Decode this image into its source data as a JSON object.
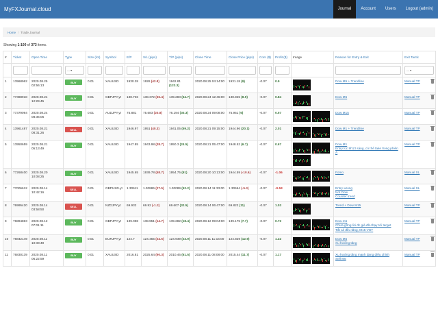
{
  "nav": {
    "brand": "MyFXJournal.cloud",
    "items": [
      {
        "label": "Journal",
        "active": true
      },
      {
        "label": "Account",
        "active": false
      },
      {
        "label": "Users",
        "active": false
      },
      {
        "label": "Logout (admin)",
        "active": false
      }
    ]
  },
  "breadcrumb": {
    "home": "Home",
    "current": "Trade Journal"
  },
  "summary": {
    "prefix": "Showing ",
    "range": "1-100",
    "mid": " of ",
    "total": "373",
    "suffix": " items."
  },
  "filter_select_value": "---",
  "columns": [
    "#",
    "Ticket",
    "Open Time",
    "Type",
    "Size (lot)",
    "Symbol",
    "E/P",
    "S/L (pips)",
    "T/P (pips)",
    "Close Time",
    "Close Price (pips)",
    "Com ($)",
    "Profit ($)",
    "Image",
    "Reason for Entry & Exit",
    "Exit Tactic"
  ],
  "colors": {
    "navbar": "#3b74b0",
    "buy": "#5cb85c",
    "sell": "#d9534f",
    "link": "#337ab7"
  },
  "rows": [
    {
      "no": "1",
      "ticket": "13968962",
      "open_date": "2020.08.25",
      "open_time": "02:56:13",
      "type": "BUY",
      "size": "0.01",
      "symbol": "XAUUSD",
      "ep": "1930.28",
      "sl": "1926",
      "sl_pips": "(42.8)",
      "tp": "1942.81",
      "tp_pips": "(123.3)",
      "close_time": "2020.08.25 04:14:00",
      "close_price": "1931.18",
      "close_pips": "(9)",
      "com": "-0.07",
      "profit": "0.9",
      "images": 1,
      "reasons": [
        "Dow M5 + Trendline"
      ],
      "tactic": "Manual TP"
    },
    {
      "no": "2",
      "ticket": "77388918",
      "open_date": "2020.08.24",
      "open_time": "12:29:45",
      "type": "BUY",
      "size": "0.01",
      "symbol": "GBPJPY.yt",
      "ep": "138.736",
      "sl": "138.372",
      "sl_pips": "(36.4)",
      "tp": "139.283",
      "tp_pips": "(54.7)",
      "close_time": "2020.08.24 12:46:00",
      "close_price": "138.825",
      "close_pips": "(8.9)",
      "com": "-0.07",
      "profit": "0.84",
      "images": 1,
      "reasons": [
        "Dow M5"
      ],
      "tactic": "Manual TP"
    },
    {
      "no": "3",
      "ticket": "77379094",
      "open_date": "2020.08.24",
      "open_time": "08:36:06",
      "type": "BUY",
      "size": "0.01",
      "symbol": "AUDJPY.yt",
      "ep": "75.881",
      "sl": "75.683",
      "sl_pips": "(20.8)",
      "tp": "76.194",
      "tp_pips": "(30.3)",
      "close_time": "2020.08.24 09:08:00",
      "close_price": "75.951",
      "close_pips": "(6)",
      "com": "-0.07",
      "profit": "0.57",
      "images": 2,
      "reasons": [
        "Dow M15"
      ],
      "tactic": "Manual TP"
    },
    {
      "no": "4",
      "ticket": "13961487",
      "open_date": "2020.08.21",
      "open_time": "08:31:26",
      "type": "SELL",
      "size": "0.01",
      "symbol": "XAUUSD",
      "ep": "1946.97",
      "sl": "1951",
      "sl_pips": "(40.3)",
      "tp": "1941.05",
      "tp_pips": "(59.2)",
      "close_time": "2020.08.21 09:15:00",
      "close_price": "1944.96",
      "close_pips": "(20.1)",
      "com": "-0.07",
      "profit": "2.01",
      "images": 2,
      "reasons": [
        "Dow M1 + Trendline"
      ],
      "tactic": "Manual TP"
    },
    {
      "no": "5",
      "ticket": "13950659",
      "open_date": "2020.08.21",
      "open_time": "05:13:49",
      "type": "BUY",
      "size": "0.01",
      "symbol": "XAUUSD",
      "ep": "1947.85",
      "sl": "1943.98",
      "sl_pips": "(38.7)",
      "tp": "1950.3",
      "tp_pips": "(24.5)",
      "close_time": "2020.08.21 05:47:00",
      "close_price": "1948.52",
      "close_pips": "(6.7)",
      "com": "-0.07",
      "profit": "0.67",
      "images": 3,
      "reasons": [
        "Dow M1",
        "Entry lúc 9h13 sáng, có thể take trong phiên Á"
      ],
      "tactic": "Manual TP"
    },
    {
      "no": "6",
      "ticket": "77268400",
      "open_date": "2020.08.20",
      "open_time": "10:08:25",
      "type": "BUY",
      "size": "0.01",
      "symbol": "XAUUSD",
      "ep": "1945.65",
      "sl": "1939.78",
      "sl_pips": "(58.7)",
      "tp": "1954.75",
      "tp_pips": "(91)",
      "close_time": "2020.08.20 10:13:00",
      "close_price": "1944.59",
      "close_pips": "(-10.6)",
      "com": "-0.07",
      "profit": "-1.06",
      "images": 2,
      "reasons": [
        "Fomo"
      ],
      "tactic": "Manual SL"
    },
    {
      "no": "7",
      "ticket": "77006612",
      "open_date": "2020.08.14",
      "open_time": "10:42:16",
      "type": "SELL",
      "size": "0.01",
      "symbol": "GBPUSD.yt",
      "ep": "1.30611",
      "sl": "1.30886",
      "sl_pips": "(27.5)",
      "tp": "1.30089",
      "tp_pips": "(52.2)",
      "close_time": "2020.08.14 11:33:00",
      "close_price": "1.30664",
      "close_pips": "(-5.3)",
      "com": "-0.07",
      "profit": "-0.53",
      "images": 2,
      "reasons": [
        "Entry wrong",
        "Not Dow",
        "Counter trend"
      ],
      "tactic": "Manual SL"
    },
    {
      "no": "8",
      "ticket": "76995420",
      "open_date": "2020.08.14",
      "open_time": "03:58:50",
      "type": "SELL",
      "size": "0.01",
      "symbol": "NZDJPY.yt",
      "ep": "69.932",
      "sl": "69.92",
      "sl_pips": "(-1.2)",
      "tp": "69.607",
      "tp_pips": "(32.5)",
      "close_time": "2020.08.14 06:47:00",
      "close_price": "69.822",
      "close_pips": "(11)",
      "com": "-0.07",
      "profit": "1.03",
      "images": 1,
      "reasons": [
        "Trend + Dow M15"
      ],
      "tactic": "Manual TP"
    },
    {
      "no": "9",
      "ticket": "76894863",
      "open_date": "2020.08.12",
      "open_time": "07:01:11",
      "type": "BUY",
      "size": "0.01",
      "symbol": "GBPJPY.yt",
      "ep": "139.098",
      "sl": "138.951",
      "sl_pips": "(14.7)",
      "tp": "139.282",
      "tp_pips": "(18.4)",
      "close_time": "2020.08.12 09:04:00",
      "close_price": "139.175",
      "close_pips": "(7.7)",
      "com": "-0.07",
      "profit": "0.72",
      "images": 2,
      "reasons": [
        "Dow m5",
        "Chưa gồng lời đc giá đã chạy tới target",
        "Tất cả đều tăng, M15 VGT"
      ],
      "tactic": "Manual TP"
    },
    {
      "no": "10",
      "ticket": "76842149",
      "open_date": "2020.08.11",
      "open_time": "10:33:49",
      "type": "BUY",
      "size": "0.01",
      "symbol": "EURJPY.yt",
      "ep": "124.7",
      "sl": "124.455",
      "sl_pips": "(24.5)",
      "tp": "124.939",
      "tp_pips": "(23.9)",
      "close_time": "2020.08.11 11:16:00",
      "close_price": "124.829",
      "close_pips": "(12.9)",
      "com": "-0.07",
      "profit": "1.22",
      "images": 2,
      "reasons": [
        "Dow M5",
        "Xu hướng tăng"
      ],
      "tactic": "Manual TP"
    },
    {
      "no": "11",
      "ticket": "76830139",
      "open_date": "2020.08.11",
      "open_time": "06:22:59",
      "type": "BUY",
      "size": "0.01",
      "symbol": "XAUUSD",
      "ep": "2016.81",
      "sl": "2025.64",
      "sl_pips": "(90.3)",
      "tp": "2010.46",
      "tp_pips": "(61.5)",
      "close_time": "2020.08.11 08:08:00",
      "close_price": "2015.44",
      "close_pips": "(11.7)",
      "com": "-0.07",
      "profit": "1.17",
      "images": 2,
      "reasons": [
        "Xu hướng tăng mạnh đang điều chỉnh",
        "Sell M5"
      ],
      "tactic": "Manual TP"
    }
  ]
}
